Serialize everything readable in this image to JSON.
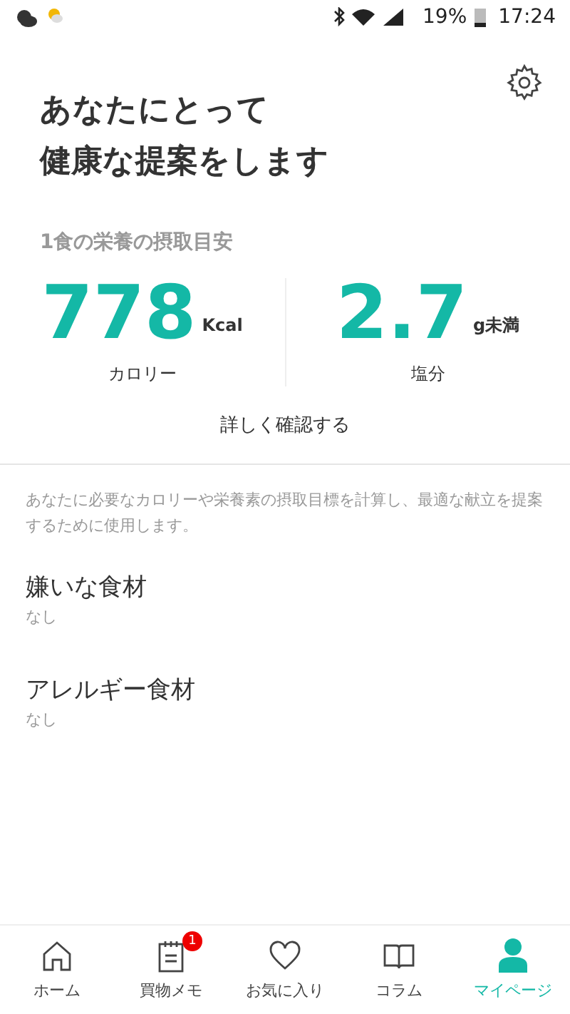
{
  "status_bar": {
    "battery": "19%",
    "time": "17:24"
  },
  "title_lines": [
    "あなたにとって",
    "健康な提案をします"
  ],
  "nutrition": {
    "heading": "1食の栄養の摂取目安",
    "metrics": [
      {
        "value": "778",
        "unit": "Kcal",
        "label": "カロリー"
      },
      {
        "value": "2.7",
        "unit": "g未満",
        "label": "塩分"
      }
    ],
    "details_link": "詳しく確認する"
  },
  "description": "あなたに必要なカロリーや栄養素の摂取目標を計算し、最適な献立を提案するために使用します。",
  "settings": [
    {
      "title": "嫌いな食材",
      "value": "なし"
    },
    {
      "title": "アレルギー食材",
      "value": "なし"
    }
  ],
  "tab_bar": [
    {
      "kind": "home",
      "label": "ホーム",
      "selected": false
    },
    {
      "kind": "memo",
      "label": "買物メモ",
      "selected": false,
      "badge": "1"
    },
    {
      "kind": "favorite",
      "label": "お気に入り",
      "selected": false
    },
    {
      "kind": "column",
      "label": "コラム",
      "selected": false
    },
    {
      "kind": "mypage",
      "label": "マイページ",
      "selected": true
    }
  ]
}
